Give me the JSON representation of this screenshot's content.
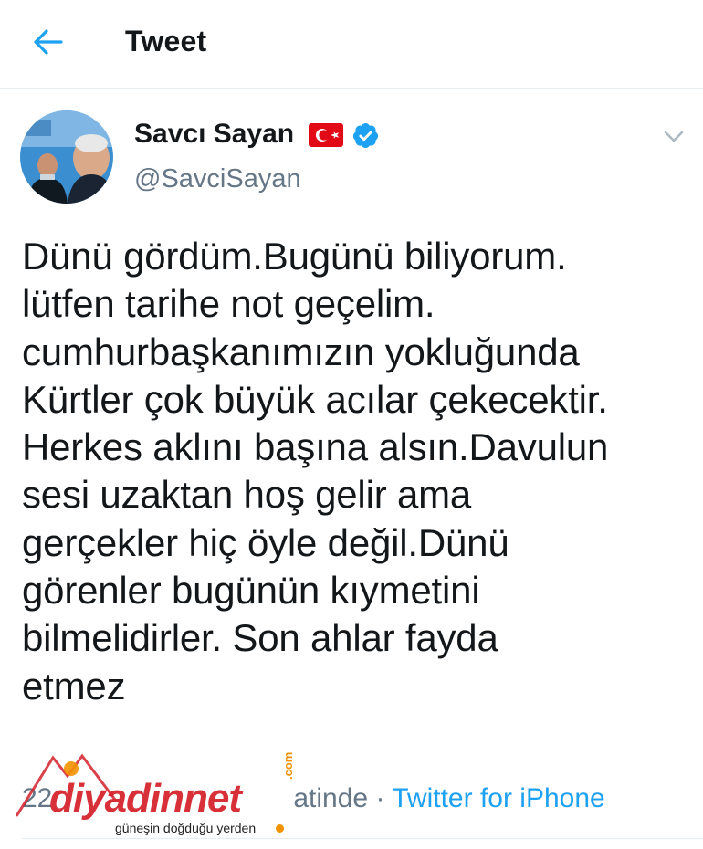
{
  "header": {
    "title": "Tweet"
  },
  "tweet": {
    "author": {
      "name": "Savcı Sayan",
      "handle": "@SavciSayan"
    },
    "text": "Dünü gördüm.Bugünü biliyorum.\nlütfen tarihe not geçelim.\ncumhurbaşkanımızın yokluğunda\nKürtler çok büyük acılar çekecektir.\nHerkes aklını başına alsın.Davulun\nsesi uzaktan hoş gelir ama\ngerçekler hiç öyle değil.Dünü\ngörenler bugünün kıymetini\nbilmelidirler. Son ahlar fayda\netmez",
    "meta_time": "22",
    "meta_time_suffix": "atinde",
    "meta_separator": "·",
    "source": "Twitter for iPhone"
  },
  "watermark": {
    "name": "diyadinnet",
    "tld": ".com",
    "slogan": "güneşin doğduğu yerden"
  },
  "colors": {
    "accent": "#1da1f2",
    "muted": "#657786",
    "flag_red": "#e30a17",
    "watermark_red": "#d4212b",
    "watermark_orange": "#f39200"
  },
  "icons": {
    "back": "arrow-left-icon",
    "verified": "verified-badge-icon",
    "flag": "turkey-flag-icon",
    "caret": "chevron-down-icon"
  }
}
